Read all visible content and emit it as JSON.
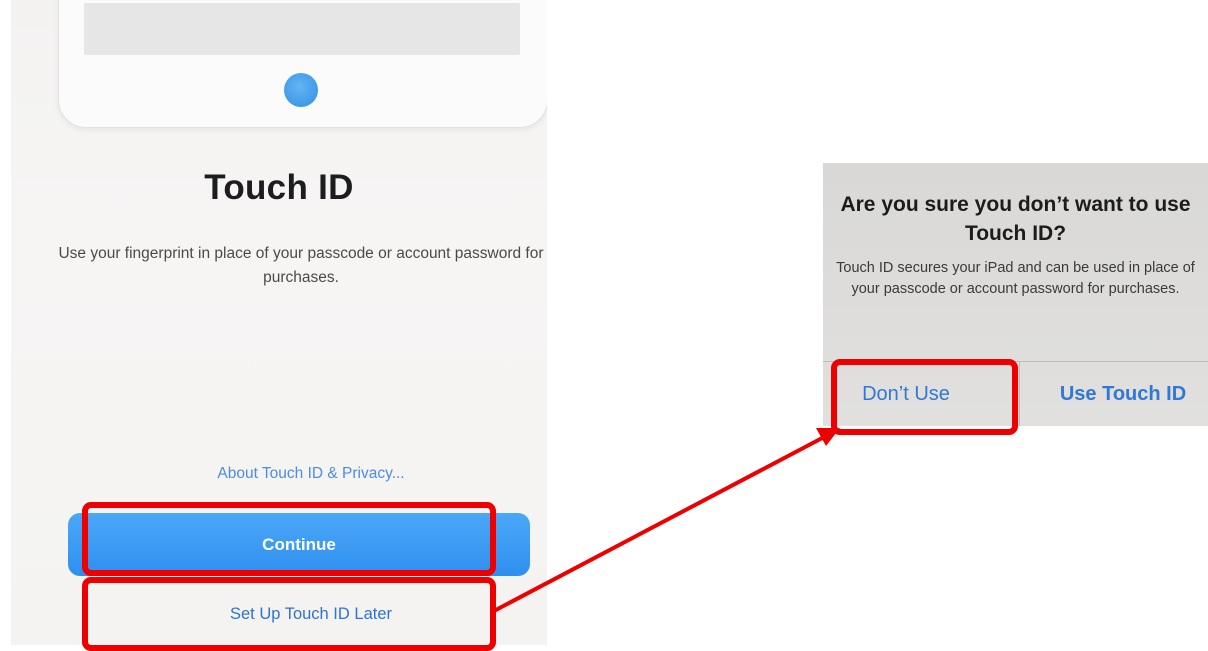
{
  "setup_screen": {
    "title": "Touch ID",
    "description": "Use your fingerprint in place of your passcode or account password for purchases.",
    "privacy_link": "About Touch ID & Privacy...",
    "continue_button": "Continue",
    "setup_later_button": "Set Up Touch ID Later",
    "home_button_icon": "fingerprint-home-button-icon"
  },
  "alert_dialog": {
    "title": "Are you sure you don’t want to use Touch ID?",
    "message": "Touch ID secures your iPad and can be used in place of your passcode or account password for purchases.",
    "buttons": [
      {
        "label": "Don’t Use"
      },
      {
        "label": "Use Touch ID"
      }
    ]
  },
  "annotation": {
    "highlight_color": "#ee0000",
    "arrow_icon": "red-arrow-icon"
  },
  "colors": {
    "primary_blue": "#2f8fee",
    "link_blue": "#2c73d2",
    "title_text": "#1d1d1f"
  }
}
